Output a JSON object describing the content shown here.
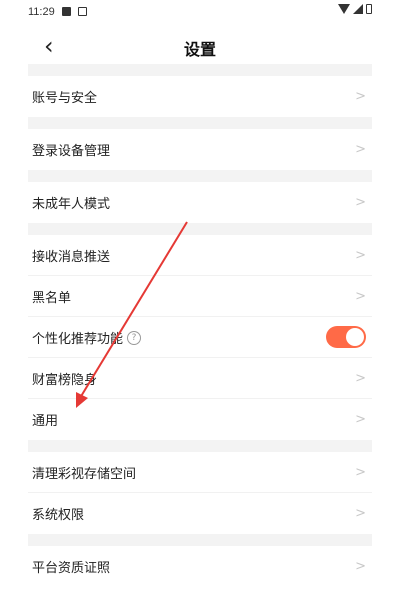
{
  "status_bar": {
    "time": "11:29"
  },
  "header": {
    "title": "设置",
    "back_icon": "chevron-left-icon"
  },
  "colors": {
    "accent": "#ff6a47",
    "arrow": "#e53935",
    "section_gap": "#f3f3f3"
  },
  "sections": [
    {
      "items": [
        {
          "label": "账号与安全",
          "chevron": ">"
        }
      ]
    },
    {
      "items": [
        {
          "label": "登录设备管理",
          "chevron": ">"
        }
      ]
    },
    {
      "items": [
        {
          "label": "未成年人模式",
          "chevron": ">"
        }
      ]
    },
    {
      "items": [
        {
          "label": "接收消息推送",
          "chevron": ">"
        },
        {
          "label": "黑名单",
          "chevron": ">"
        },
        {
          "label": "个性化推荐功能",
          "help": "?",
          "toggle_on": true
        },
        {
          "label": "财富榜隐身",
          "chevron": ">"
        },
        {
          "label": "通用",
          "chevron": ">"
        }
      ]
    },
    {
      "items": [
        {
          "label": "清理彩视存储空间",
          "chevron": ">"
        },
        {
          "label": "系统权限",
          "chevron": ">"
        }
      ]
    },
    {
      "items": [
        {
          "label": "平台资质证照",
          "chevron": ">"
        }
      ]
    }
  ]
}
